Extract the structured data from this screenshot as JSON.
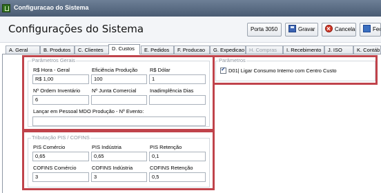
{
  "window": {
    "title": "Configuracao do Sistema"
  },
  "header": {
    "page_title": "Configurações do Sistema",
    "buttons": {
      "porta": "Porta 3050",
      "gravar": "Gravar",
      "cancelar": "Cancelar",
      "fechar": "Fec"
    }
  },
  "tabs": [
    {
      "label": "A. Geral"
    },
    {
      "label": "B. Produtos"
    },
    {
      "label": "C. Clientes"
    },
    {
      "label": "D. Custos"
    },
    {
      "label": "E. Pedidos"
    },
    {
      "label": "F. Producao"
    },
    {
      "label": "G. Expedicao"
    },
    {
      "label": "H. Compras"
    },
    {
      "label": "I. Recebimento"
    },
    {
      "label": "J. ISO"
    },
    {
      "label": "K. Contáb"
    }
  ],
  "gerais": {
    "group_label": "Parâmetros Gerais",
    "hora_geral": {
      "label": "R$ Hora - Geral",
      "value": "R$ 1,00"
    },
    "eficiencia": {
      "label": "Eficiência Produção",
      "value": "100"
    },
    "dolar": {
      "label": "R$ Dólar",
      "value": "1"
    },
    "ordem_inventario": {
      "label": "Nº Ordem Inventário",
      "value": "6"
    },
    "junta_comercial": {
      "label": "Nº Junta Comercial",
      "value": ""
    },
    "inadimplencia": {
      "label": "Inadimplência Dias",
      "value": ""
    },
    "mdo_evento": {
      "label": "Lançar em Pessoal MDO Produção - Nº Evento:",
      "value": ""
    }
  },
  "tributacao": {
    "group_label": "Tributação PIS / COFINS",
    "pis_comercio": {
      "label": "PIS Comércio",
      "value": "0,65"
    },
    "pis_industria": {
      "label": "PIS Indústria",
      "value": "0,65"
    },
    "pis_retencao": {
      "label": "PIS Retenção",
      "value": "0,1"
    },
    "cofins_comercio": {
      "label": "COFINS Comércio",
      "value": "3"
    },
    "cofins_industria": {
      "label": "COFINS Indústria",
      "value": "3"
    },
    "cofins_retencao": {
      "label": "COFINS Retenção",
      "value": "0,5"
    }
  },
  "parametros": {
    "group_label": "Parâmetros",
    "consumo_interno": {
      "label": "D01| Ligar Consumo Interno com Centro Custo",
      "checked": true
    }
  },
  "colors": {
    "highlight": "#c0434b",
    "titlebar": "#4a5c73"
  }
}
